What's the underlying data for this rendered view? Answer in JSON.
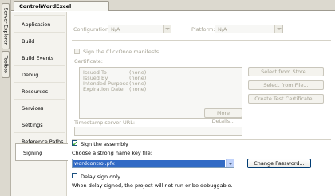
{
  "side_panels": {
    "server_explorer_label": "Server Explorer",
    "toolbox_label": "Toolbox"
  },
  "document_tab": {
    "title": "ControlWordExcel"
  },
  "nav": {
    "items": [
      "Application",
      "Build",
      "Build Events",
      "Debug",
      "Resources",
      "Services",
      "Settings",
      "Reference Paths",
      "Signing"
    ],
    "active": "Signing"
  },
  "config_bar": {
    "configuration_label": "Configuration:",
    "configuration_value": "N/A",
    "platform_label": "Platform:",
    "platform_value": "N/A"
  },
  "clickonce": {
    "checkbox_label": "Sign the ClickOnce manifests",
    "checked": false,
    "certificate_label": "Certificate:",
    "rows": [
      {
        "label": "Issued To",
        "value": "(none)"
      },
      {
        "label": "Issued By",
        "value": "(none)"
      },
      {
        "label": "Intended Purpose",
        "value": "(none)"
      },
      {
        "label": "Expiration Date",
        "value": "(none)"
      }
    ],
    "select_from_store_label": "Select from Store...",
    "select_from_file_label": "Select from File...",
    "create_test_cert_label": "Create Test Certificate...",
    "more_details_label": "More Details...",
    "timestamp_label": "Timestamp server URL:",
    "timestamp_value": ""
  },
  "assembly": {
    "checkbox_label": "Sign the assembly",
    "checked": true,
    "key_file_label": "Choose a strong name key file:",
    "key_file_value": "wordcontrol.pfx",
    "change_password_label": "Change Password...",
    "delay_sign_label": "Delay sign only",
    "delay_sign_checked": false,
    "delay_note": "When delay signed, the project will not run or be debuggable."
  },
  "colors": {
    "selection": "#316ac5",
    "panel": "#f4f3ee",
    "disabled_text": "#a5a293",
    "check_mark": "#21a121"
  }
}
